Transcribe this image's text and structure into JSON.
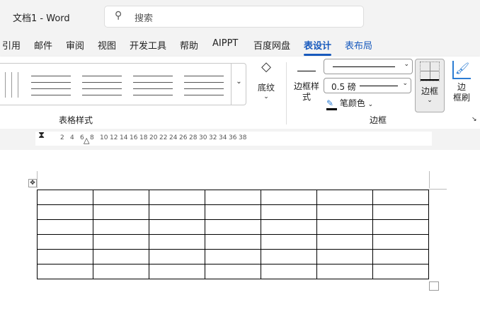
{
  "title": "文档1  -  Word",
  "search": {
    "placeholder": "搜索"
  },
  "tabs": [
    "引用",
    "邮件",
    "审阅",
    "视图",
    "开发工具",
    "帮助",
    "AIPPT",
    "百度网盘",
    "表设计",
    "表布局"
  ],
  "active_tab": "表设计",
  "ribbon": {
    "table_styles_label": "表格样式",
    "shading_label": "底纹",
    "border_styles_label": "边框样\n式",
    "line_weight": "0.5 磅",
    "pen_color_label": "笔颜色",
    "borders_label": "边框",
    "border_painter_label": "边\n框刷",
    "borders_group_label": "边框"
  },
  "ruler": {
    "ticks": [
      "2",
      "4",
      "6",
      "8",
      "10",
      "12",
      "14",
      "16",
      "18",
      "20",
      "22",
      "24",
      "26",
      "28",
      "30",
      "32",
      "34",
      "36",
      "38"
    ]
  },
  "table": {
    "rows": 6,
    "cols": 7
  }
}
